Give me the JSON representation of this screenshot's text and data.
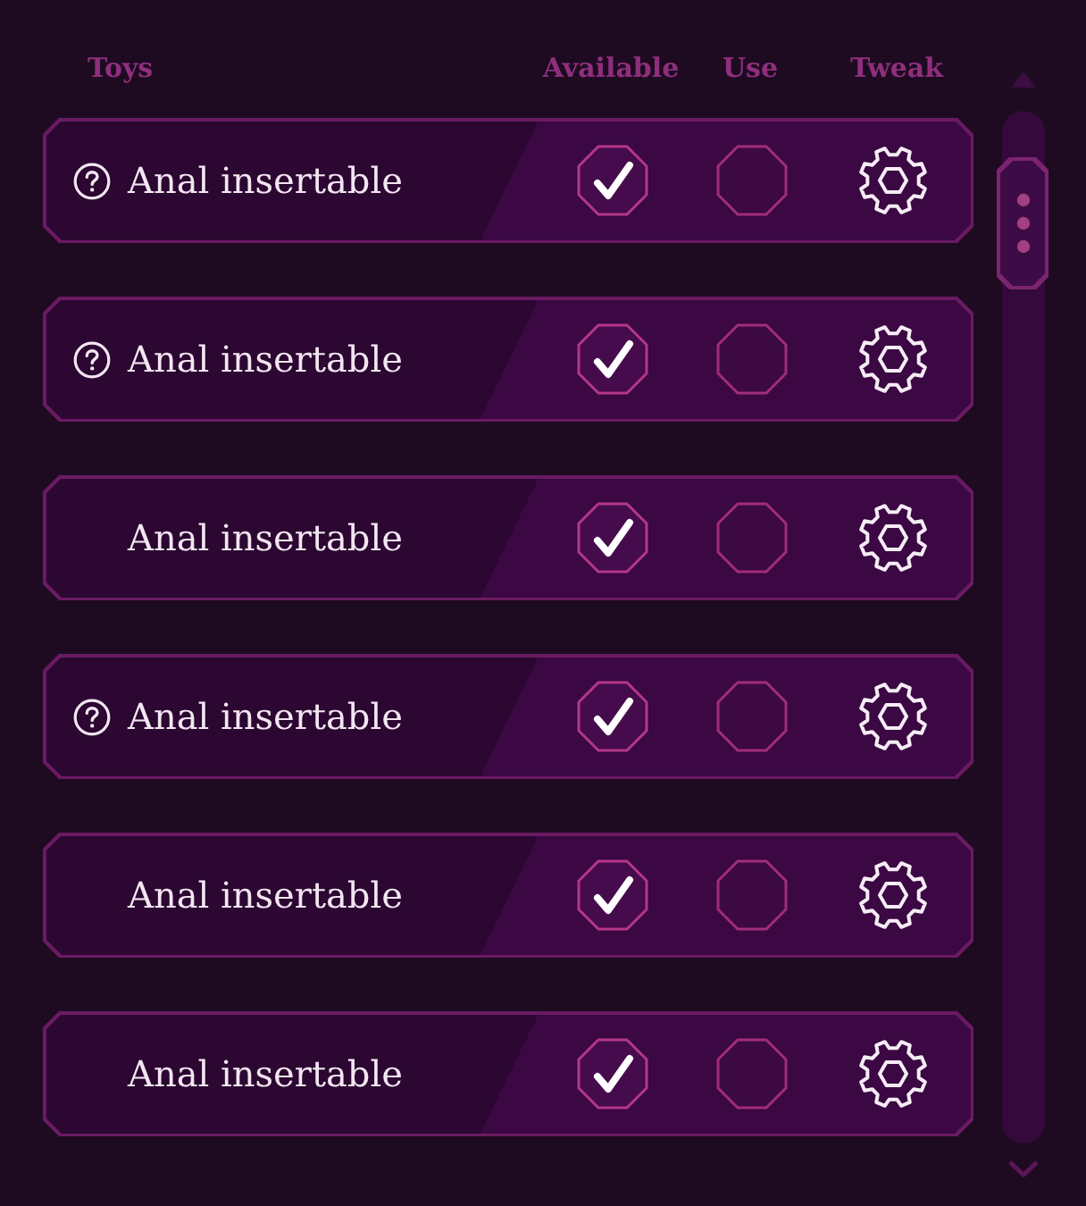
{
  "columns": [
    {
      "label": "Toys"
    },
    {
      "label": "Available"
    },
    {
      "label": "Use"
    },
    {
      "label": "Tweak"
    }
  ],
  "rows": [
    {
      "name": "Anal insertable",
      "help": true,
      "available": true,
      "use": false
    },
    {
      "name": "Anal insertable",
      "help": true,
      "available": true,
      "use": false
    },
    {
      "name": "Anal insertable",
      "help": false,
      "available": true,
      "use": false
    },
    {
      "name": "Anal insertable",
      "help": true,
      "available": true,
      "use": false
    },
    {
      "name": "Anal insertable",
      "help": false,
      "available": true,
      "use": false
    },
    {
      "name": "Anal insertable",
      "help": false,
      "available": true,
      "use": false
    }
  ]
}
